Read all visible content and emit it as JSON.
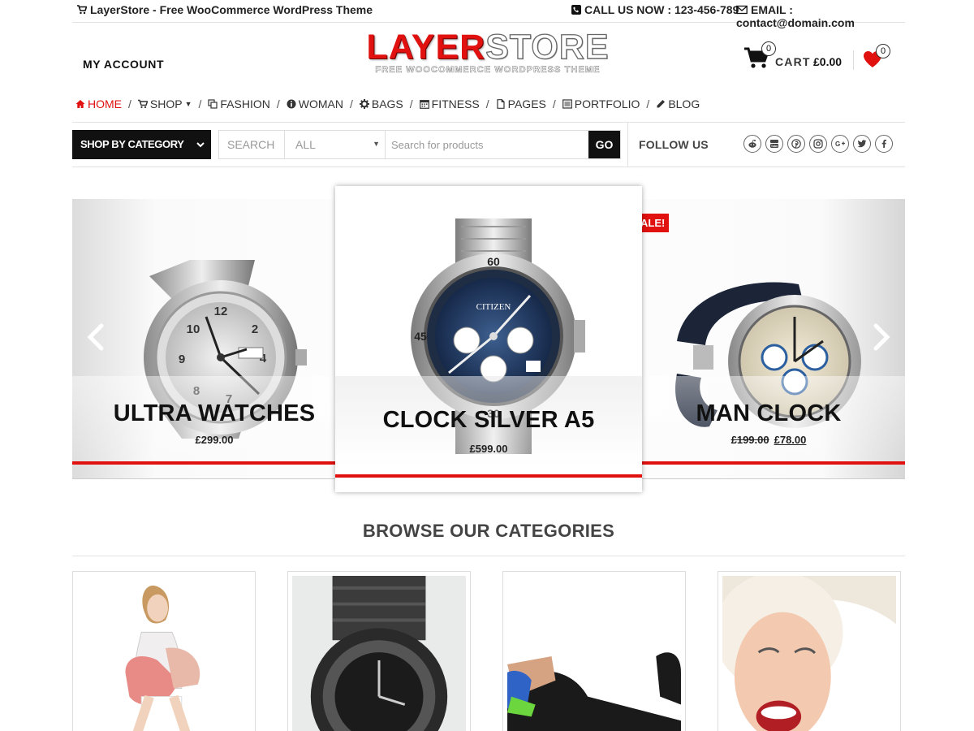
{
  "topbar": {
    "site_title": "LayerStore - Free WooCommerce WordPress Theme",
    "phone": "CALL US NOW : 123-456-789",
    "email": "EMAIL : contact@domain.com"
  },
  "header": {
    "my_account": "MY ACCOUNT",
    "logo_left": "LAYER",
    "logo_right": "STORE",
    "logo_tagline": "FREE WOOCOMMERCE WORDPRESS THEME",
    "cart_count": "0",
    "cart_label": "CART",
    "cart_total": "£0.00",
    "wishlist_count": "0"
  },
  "nav": {
    "items": [
      {
        "label": "HOME",
        "icon": "home-icon"
      },
      {
        "label": "SHOP",
        "icon": "cart-icon"
      },
      {
        "label": "FASHION",
        "icon": "copy-icon"
      },
      {
        "label": "WOMAN",
        "icon": "info-icon"
      },
      {
        "label": "BAGS",
        "icon": "gear-icon"
      },
      {
        "label": "FITNESS",
        "icon": "calendar-icon"
      },
      {
        "label": "PAGES",
        "icon": "file-icon"
      },
      {
        "label": "PORTFOLIO",
        "icon": "list-icon"
      },
      {
        "label": "BLOG",
        "icon": "pencil-icon"
      }
    ],
    "separator": "/"
  },
  "search": {
    "category_button": "SHOP BY CATEGORY",
    "label": "SEARCH",
    "select_value": "ALL",
    "placeholder": "Search for products",
    "go": "GO"
  },
  "social": {
    "label": "FOLLOW US",
    "icons": [
      "reddit-icon",
      "youtube-icon",
      "pinterest-icon",
      "instagram-icon",
      "google-plus-icon",
      "twitter-icon",
      "facebook-icon"
    ]
  },
  "slider": {
    "left": {
      "title": "ULTRA WATCHES",
      "price": "£299.00"
    },
    "center": {
      "title": "CLOCK SILVER A5",
      "price": "£599.00"
    },
    "right": {
      "title": "MAN CLOCK",
      "old_price": "£199.00",
      "price": "£78.00"
    },
    "sale_badge": "ALE!"
  },
  "categories": {
    "title": "BROWSE OUR CATEGORIES"
  },
  "colors": {
    "accent": "#e0110f",
    "dark": "#111111"
  }
}
